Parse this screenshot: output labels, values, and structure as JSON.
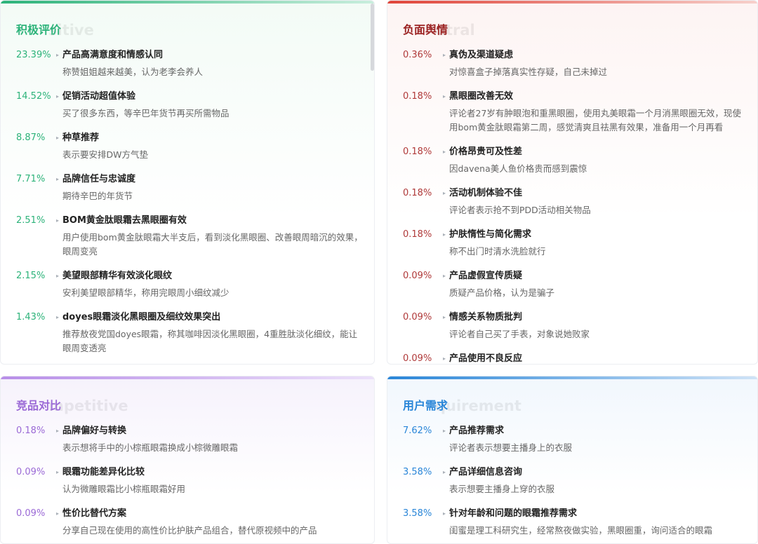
{
  "colors": {
    "positive": "#2db37a",
    "negative": "#b03a3a",
    "competitive": "#9b6ad6",
    "requirement": "#2a86d8"
  },
  "positive": {
    "title": "积极评价",
    "ghost": "sitive",
    "items": [
      {
        "pct": "23.39%",
        "name": "产品高满意度和情感认同",
        "desc": "称赞姐姐越来越美，认为老李会养人"
      },
      {
        "pct": "14.52%",
        "name": "促销活动超值体验",
        "desc": "买了很多东西，等辛巴年货节再买所需物品"
      },
      {
        "pct": "8.87%",
        "name": "种草推荐",
        "desc": "表示要安排DW方气垫"
      },
      {
        "pct": "7.71%",
        "name": "品牌信任与忠诚度",
        "desc": "期待辛巴的年货节"
      },
      {
        "pct": "2.51%",
        "name": "BOM黄金肽眼霜去黑眼圈有效",
        "desc": "用户使用bom黄金肽眼霜大半支后，看到淡化黑眼圈、改善眼周暗沉的效果，眼周变亮"
      },
      {
        "pct": "2.15%",
        "name": "美望眼部精华有效淡化眼纹",
        "desc": "安利美望眼部精华，称用完眼周小细纹减少"
      },
      {
        "pct": "1.43%",
        "name": "doyes眼霜淡化黑眼圈及细纹效果突出",
        "desc": "推荐敖夜党国doyes眼霜，称其咖啡因淡化黑眼圈，4重胜肽淡化细纹，能让眼周变透亮"
      }
    ]
  },
  "negative": {
    "title": "负面舆情",
    "ghost": "utral",
    "items": [
      {
        "pct": "0.36%",
        "name": "真伪及渠道疑虑",
        "desc": "对惊喜盒子掉落真实性存疑，自己未掉过"
      },
      {
        "pct": "0.18%",
        "name": "黑眼圈改善无效",
        "desc": "评论者27岁有肿眼泡和重黑眼圈，使用丸美眼霜一个月消黑眼圈无效，现使用bom黄金肽眼霜第二周，感觉清爽且祛黑有效果，准备用一个月再看"
      },
      {
        "pct": "0.18%",
        "name": "价格昂贵可及性差",
        "desc": "因davena美人鱼价格贵而感到震惊"
      },
      {
        "pct": "0.18%",
        "name": "活动机制体验不佳",
        "desc": "评论者表示抢不到PDD活动相关物品"
      },
      {
        "pct": "0.18%",
        "name": "护肤惰性与简化需求",
        "desc": "称不出门时清水洗脸就行"
      },
      {
        "pct": "0.09%",
        "name": "产品虚假宣传质疑",
        "desc": "质疑产品价格，认为是骗子"
      },
      {
        "pct": "0.09%",
        "name": "情感关系物质批判",
        "desc": "评论者自己买了手表，对象说她败家"
      },
      {
        "pct": "0.09%",
        "name": "产品使用不良反应",
        "desc": ""
      }
    ]
  },
  "competitive": {
    "title": "竞品对比",
    "ghost": "mpetitive",
    "items": [
      {
        "pct": "0.18%",
        "name": "品牌偏好与转换",
        "desc": "表示想将手中的小棕瓶眼霜换成小棕微雕眼霜"
      },
      {
        "pct": "0.09%",
        "name": "眼霜功能差异化比较",
        "desc": "认为微雕眼霜比小棕瓶眼霜好用"
      },
      {
        "pct": "0.09%",
        "name": "性价比替代方案",
        "desc": "分享自己现在使用的高性价比护肤产品组合，替代原视频中的产品"
      }
    ]
  },
  "requirement": {
    "title": "用户需求",
    "ghost": "quirement",
    "items": [
      {
        "pct": "7.62%",
        "name": "产品推荐需求",
        "desc": "评论者表示想要主播身上的衣服"
      },
      {
        "pct": "3.58%",
        "name": "产品详细信息咨询",
        "desc": "表示想要主播身上穿的衣服"
      },
      {
        "pct": "3.58%",
        "name": "针对年龄和问题的眼霜推荐需求",
        "desc": "闺蜜是理工科研究生，经常熬夜做实验，黑眼圈重，询问适合的眼霜"
      }
    ]
  }
}
